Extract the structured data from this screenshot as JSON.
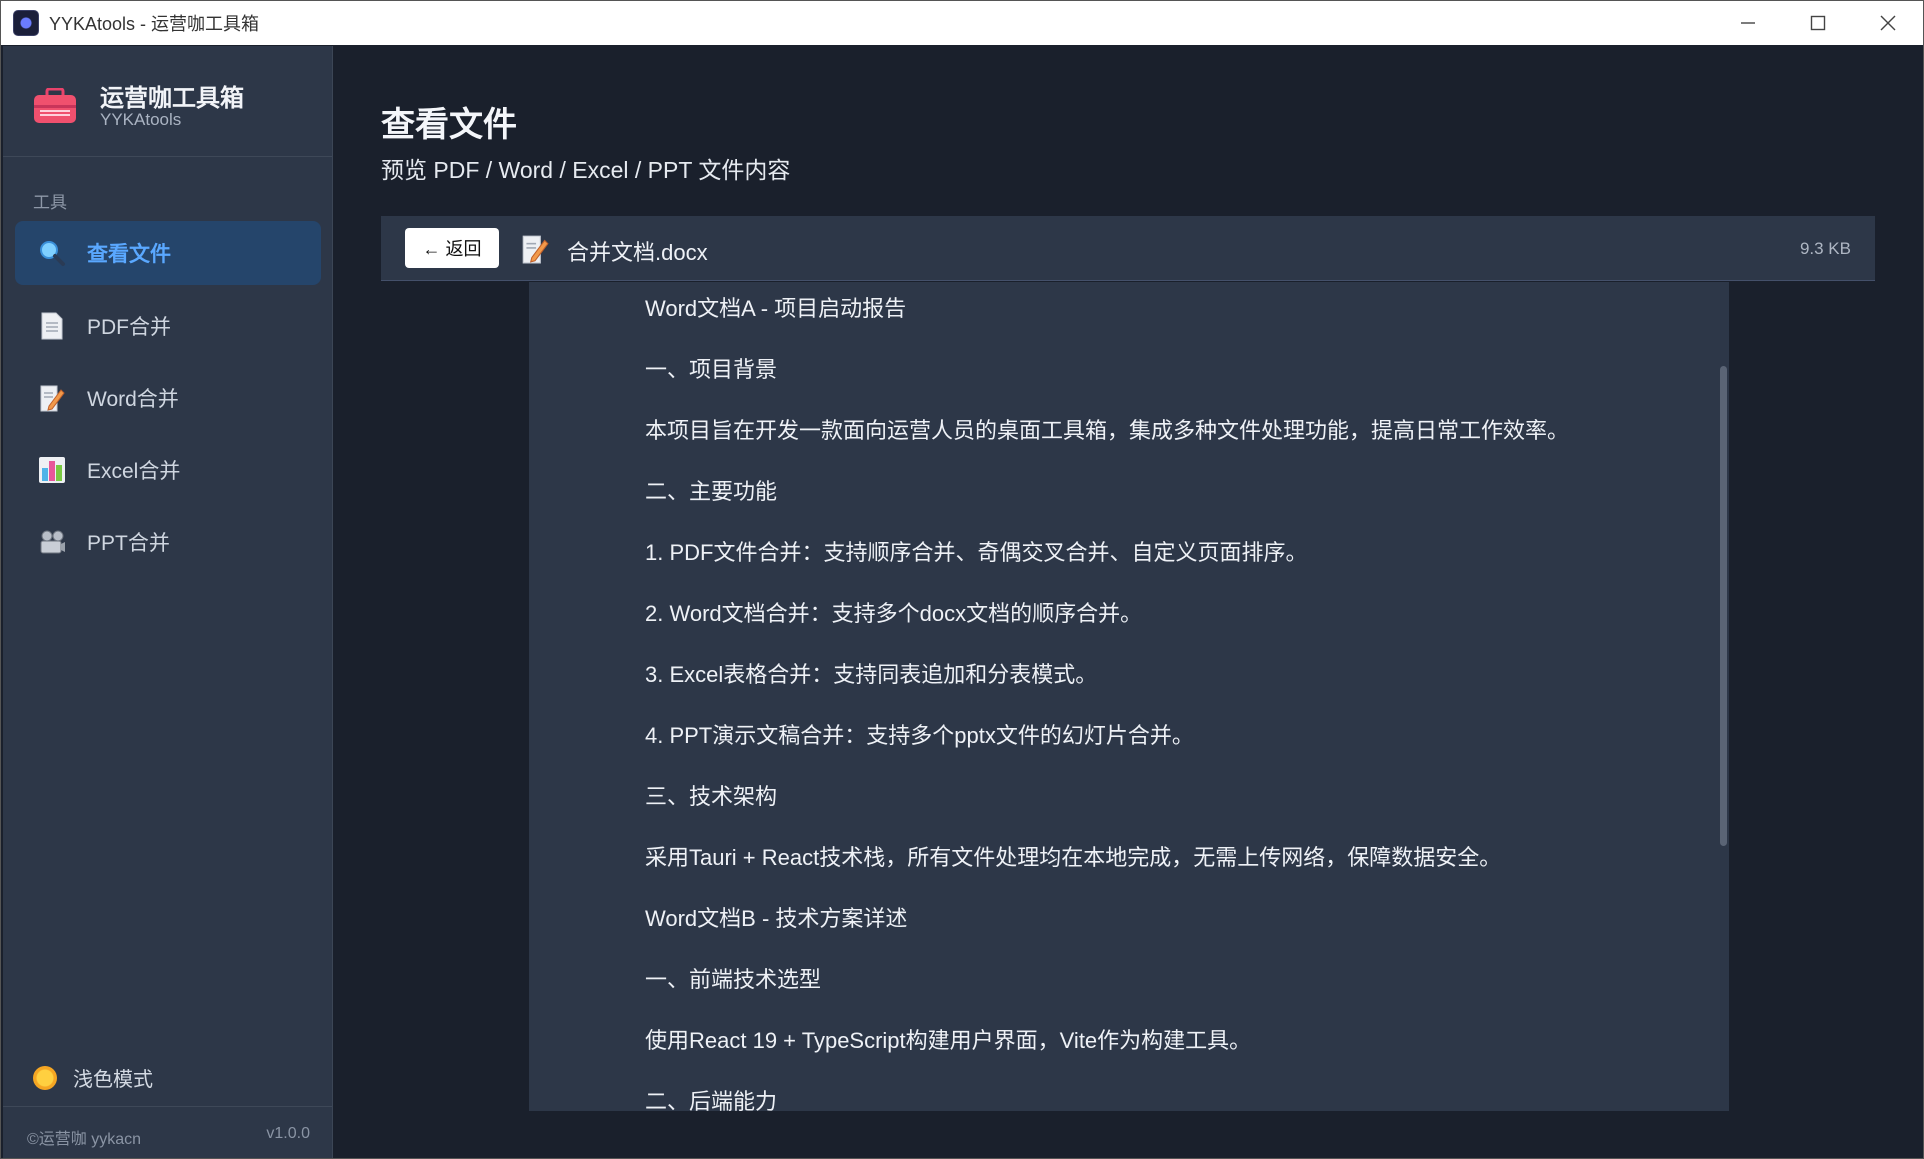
{
  "window": {
    "title": "YYKAtools - 运营咖工具箱",
    "controls": [
      "minimize",
      "maximize",
      "close"
    ]
  },
  "sidebar": {
    "brand_name": "运营咖工具箱",
    "brand_sub": "YYKAtools",
    "section_label": "工具",
    "items": [
      {
        "label": "查看文件",
        "icon": "magnifier-icon",
        "active": true
      },
      {
        "label": "PDF合并",
        "icon": "document-icon",
        "active": false
      },
      {
        "label": "Word合并",
        "icon": "memo-icon",
        "active": false
      },
      {
        "label": "Excel合并",
        "icon": "bar-chart-icon",
        "active": false
      },
      {
        "label": "PPT合并",
        "icon": "projector-icon",
        "active": false
      }
    ],
    "theme_toggle": "浅色模式",
    "footer_copyright": "©运营咖 yykacn",
    "footer_version": "v1.0.0"
  },
  "main": {
    "title": "查看文件",
    "subtitle": "预览 PDF / Word / Excel / PPT 文件内容",
    "toolbar": {
      "back_label": "← 返回",
      "file_name": "合并文档.docx",
      "file_size": "9.3 KB"
    },
    "document": {
      "paragraphs": [
        "Word文档A - 项目启动报告",
        "一、项目背景",
        "本项目旨在开发一款面向运营人员的桌面工具箱，集成多种文件处理功能，提高日常工作效率。",
        "二、主要功能",
        "1. PDF文件合并：支持顺序合并、奇偶交叉合并、自定义页面排序。",
        "2. Word文档合并：支持多个docx文档的顺序合并。",
        "3. Excel表格合并：支持同表追加和分表模式。",
        "4. PPT演示文稿合并：支持多个pptx文件的幻灯片合并。",
        "三、技术架构",
        "采用Tauri + React技术栈，所有文件处理均在本地完成，无需上传网络，保障数据安全。",
        "Word文档B - 技术方案详述",
        "一、前端技术选型",
        "使用React 19 + TypeScript构建用户界面，Vite作为构建工具。",
        "二、后端能力"
      ]
    }
  },
  "colors": {
    "sidebar_bg": "#2d3748",
    "main_bg": "#1a202c",
    "active_bg": "#25456b",
    "accent": "#5aa8ff"
  }
}
